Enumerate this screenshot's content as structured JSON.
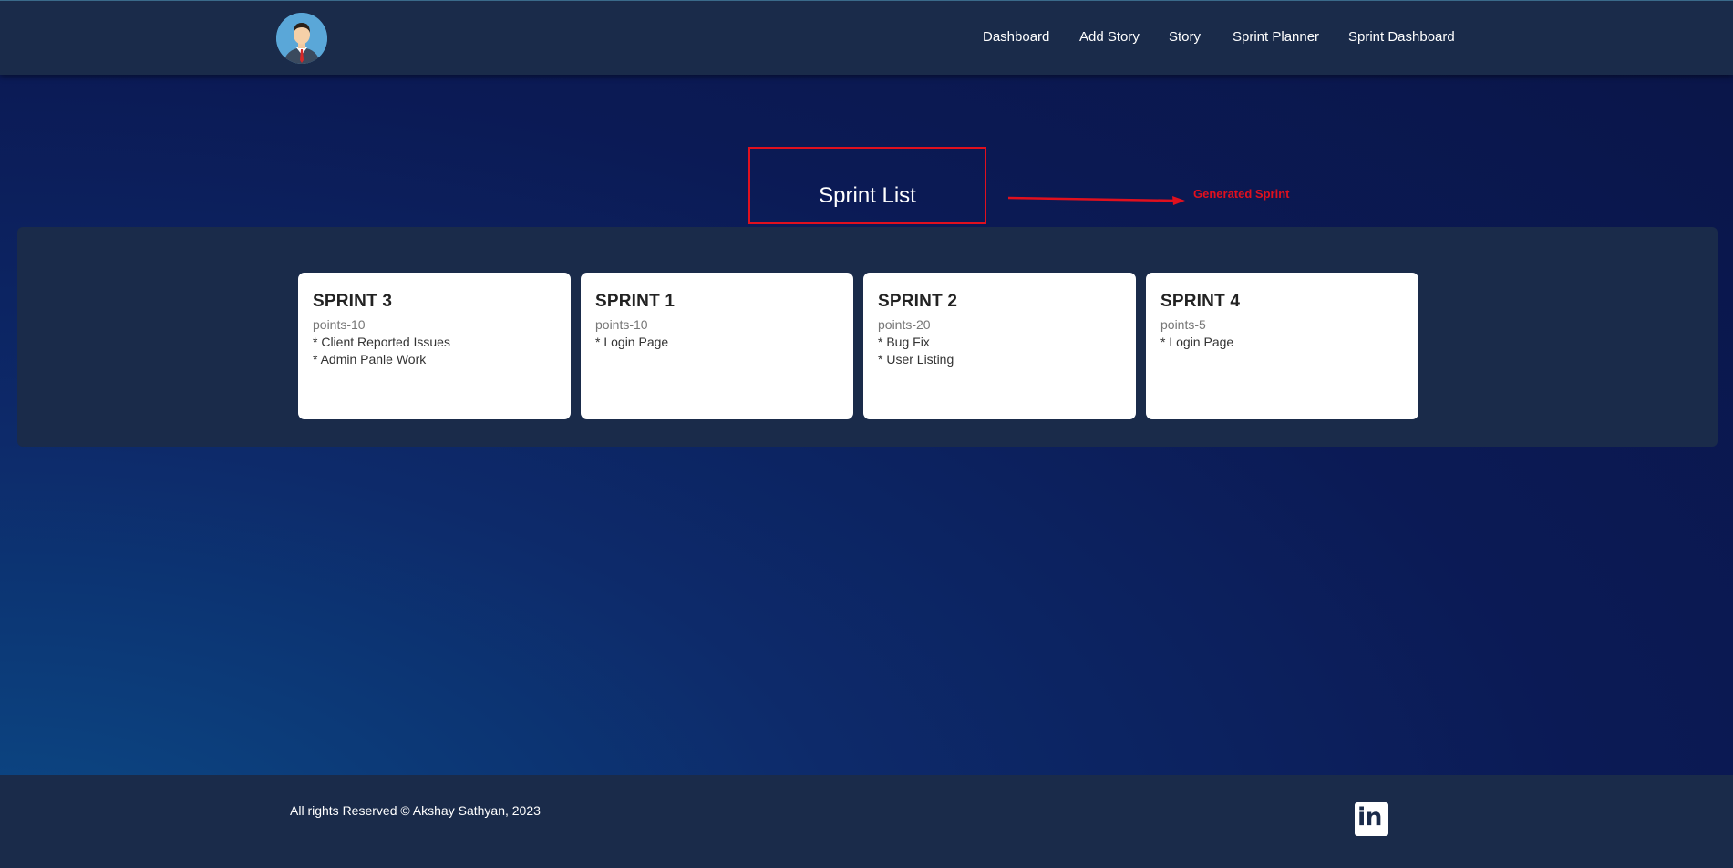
{
  "header": {
    "nav": [
      {
        "label": "Dashboard"
      },
      {
        "label": "Add Story"
      },
      {
        "label": "Story"
      },
      {
        "label": "Sprint Planner"
      },
      {
        "label": "Sprint Dashboard"
      }
    ]
  },
  "main": {
    "title": "Sprint List",
    "annotation": "Generated Sprint",
    "sprints": [
      {
        "name": "SPRINT 3",
        "points": "points-10",
        "items": [
          "* Client Reported Issues",
          "* Admin Panle Work"
        ]
      },
      {
        "name": "SPRINT 1",
        "points": "points-10",
        "items": [
          "* Login Page"
        ]
      },
      {
        "name": "SPRINT 2",
        "points": "points-20",
        "items": [
          "* Bug Fix",
          "* User Listing"
        ]
      },
      {
        "name": "SPRINT 4",
        "points": "points-5",
        "items": [
          "* Login Page"
        ]
      }
    ]
  },
  "footer": {
    "copyright": "All rights Reserved © Akshay Sathyan, 2023",
    "social_icon": "linkedin-icon",
    "linkedin_text": "in"
  },
  "colors": {
    "header_bg": "#1a2b4a",
    "annotation": "#e0101e",
    "card_bg": "#ffffff"
  }
}
